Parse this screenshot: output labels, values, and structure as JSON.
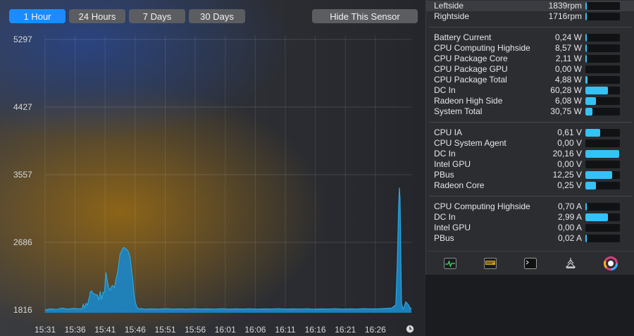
{
  "time_ranges": [
    "1 Hour",
    "24 Hours",
    "7 Days",
    "30 Days"
  ],
  "active_range": "1 Hour",
  "hide_sensor_label": "Hide This Sensor",
  "chart_data": {
    "type": "area",
    "y_ticks": [
      "5297",
      "4427",
      "3557",
      "2686",
      "1816"
    ],
    "x_ticks": [
      "15:31",
      "15:36",
      "15:41",
      "15:46",
      "15:51",
      "15:56",
      "16:01",
      "16:06",
      "16:11",
      "16:16",
      "16:21",
      "16:26"
    ],
    "ylim": [
      1816,
      5297
    ],
    "x": [
      0,
      8,
      16,
      24,
      32,
      40,
      48,
      52,
      54,
      56,
      58,
      60,
      62,
      63,
      64,
      66,
      68,
      70,
      72,
      74,
      76,
      78,
      80,
      82,
      84,
      86,
      88,
      90,
      92,
      94,
      96,
      98,
      100,
      102,
      104,
      106,
      108,
      110,
      112,
      114,
      116,
      118,
      120,
      122,
      124,
      126,
      128,
      130,
      132,
      134,
      136,
      140,
      150,
      160,
      170,
      180,
      190,
      200,
      210,
      220,
      230,
      240,
      250,
      260,
      270,
      280,
      290,
      300,
      310,
      320,
      330,
      340,
      350,
      360,
      370,
      380,
      390,
      400,
      410,
      420,
      430,
      440,
      450,
      460,
      470,
      480,
      490,
      496,
      498,
      500,
      501,
      502,
      503,
      504,
      506,
      508,
      510,
      512,
      514,
      516,
      518
    ],
    "values": [
      1816,
      1830,
      1822,
      1840,
      1826,
      1835,
      1830,
      1830,
      1890,
      1845,
      1900,
      1880,
      1960,
      1990,
      2050,
      2060,
      2030,
      2020,
      2010,
      2010,
      1940,
      2055,
      1950,
      2040,
      2050,
      2300,
      2185,
      2100,
      2070,
      2120,
      2130,
      2100,
      2200,
      2280,
      2390,
      2530,
      2570,
      2610,
      2620,
      2600,
      2590,
      2560,
      2500,
      2350,
      2200,
      2000,
      1900,
      1850,
      1830,
      1830,
      1835,
      1825,
      1830,
      1826,
      1832,
      1828,
      1830,
      1826,
      1831,
      1828,
      1830,
      1827,
      1832,
      1826,
      1830,
      1828,
      1831,
      1827,
      1830,
      1828,
      1832,
      1826,
      1830,
      1828,
      1831,
      1827,
      1830,
      1828,
      1832,
      1826,
      1830,
      1828,
      1832,
      1830,
      1830,
      1835,
      1840,
      1880,
      2400,
      3150,
      3390,
      3250,
      2600,
      1900,
      1830,
      1860,
      1920,
      1900,
      1880,
      1840,
      1840
    ],
    "color": "#2aa8e0"
  },
  "panel": {
    "fans": [
      {
        "label": "Leftside",
        "value": "1839rpm",
        "level": 0.03
      },
      {
        "label": "Rightside",
        "value": "1716rpm",
        "level": 0.03
      }
    ],
    "power": [
      {
        "label": "Battery Current",
        "value": "0,24 W",
        "level": 0.02
      },
      {
        "label": "CPU Computing Highside",
        "value": "8,57 W",
        "level": 0.05
      },
      {
        "label": "CPU Package Core",
        "value": "2,11 W",
        "level": 0.03
      },
      {
        "label": "CPU Package GPU",
        "value": "0,00 W",
        "level": 0.0
      },
      {
        "label": "CPU Package Total",
        "value": "4,88 W",
        "level": 0.06
      },
      {
        "label": "DC In",
        "value": "60,28 W",
        "level": 0.65
      },
      {
        "label": "Radeon High Side",
        "value": "6,08 W",
        "level": 0.3
      },
      {
        "label": "System Total",
        "value": "30,75 W",
        "level": 0.2
      }
    ],
    "voltage": [
      {
        "label": "CPU IA",
        "value": "0,61 V",
        "level": 0.42
      },
      {
        "label": "CPU System Agent",
        "value": "0,00 V",
        "level": 0.0
      },
      {
        "label": "DC In",
        "value": "20,16 V",
        "level": 0.98
      },
      {
        "label": "Intel GPU",
        "value": "0,00 V",
        "level": 0.0
      },
      {
        "label": "PBus",
        "value": "12,25 V",
        "level": 0.78
      },
      {
        "label": "Radeon Core",
        "value": "0,25 V",
        "level": 0.3
      }
    ],
    "current": [
      {
        "label": "CPU Computing Highside",
        "value": "0,70 A",
        "level": 0.05
      },
      {
        "label": "DC In",
        "value": "2,99 A",
        "level": 0.65
      },
      {
        "label": "Intel GPU",
        "value": "0,00 A",
        "level": 0.0
      },
      {
        "label": "PBus",
        "value": "0,02 A",
        "level": 0.03
      }
    ],
    "toolbar_icons": [
      "activity-monitor-icon",
      "console-log-icon",
      "terminal-icon",
      "sensor-settings-icon",
      "color-wheel-icon"
    ]
  }
}
